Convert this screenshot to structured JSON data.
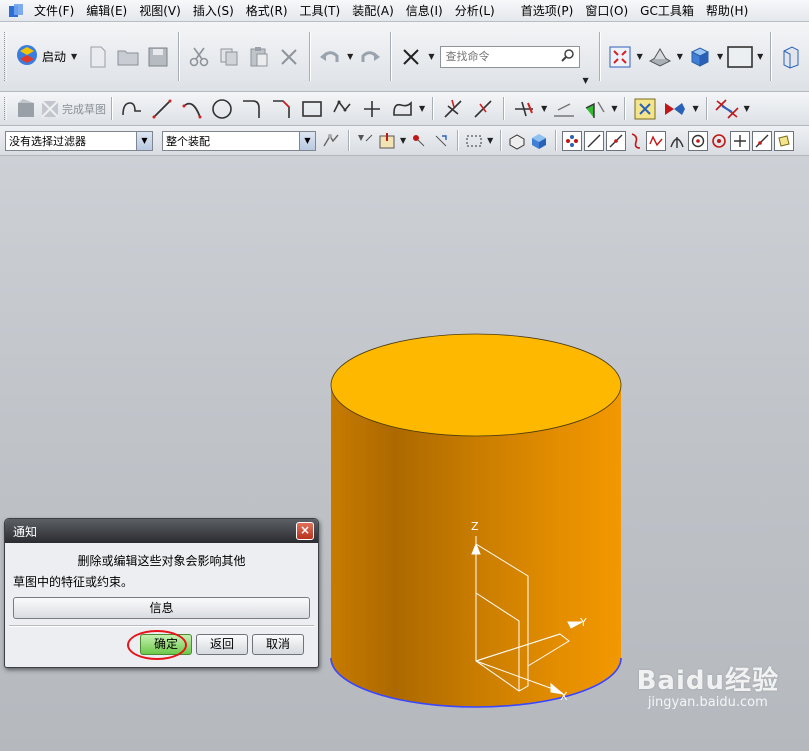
{
  "menu": {
    "items": [
      "文件(F)",
      "编辑(E)",
      "视图(V)",
      "插入(S)",
      "格式(R)",
      "工具(T)",
      "装配(A)",
      "信息(I)",
      "分析(L)",
      "首选项(P)",
      "窗口(O)",
      "GC工具箱",
      "帮助(H)"
    ]
  },
  "toolbar1": {
    "start_label": "启动",
    "search_placeholder": "查找命令"
  },
  "toolbar2": {
    "finish_sketch_label": "完成草图"
  },
  "toolbar3": {
    "filter_value": "没有选择过滤器",
    "scope_value": "整个装配"
  },
  "viewport": {
    "axis_labels": {
      "z": "Z",
      "y": "Y",
      "x": "X"
    },
    "colors": {
      "cylinder_top": "#ffb800",
      "cylinder_side_light": "#e58f00",
      "cylinder_side_dark": "#b96d00",
      "edge_highlight": "#3a46ff"
    }
  },
  "dialog": {
    "title": "通知",
    "message_line1": "删除或编辑这些对象会影响其他",
    "message_line2": "草图中的特征或约束。",
    "info_button": "信息",
    "ok_button": "确定",
    "back_button": "返回",
    "cancel_button": "取消"
  },
  "watermark": {
    "brand": "Baidu经验",
    "url": "jingyan.baidu.com"
  }
}
